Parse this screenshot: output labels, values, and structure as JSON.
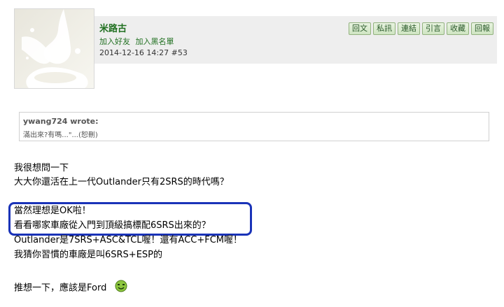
{
  "user": {
    "name": "米路古",
    "link_add_friend": "加入好友",
    "link_block": "加入黑名單",
    "post_time": "2014-12-16 14:27",
    "post_number": "#53"
  },
  "actions": [
    "回文",
    "私訊",
    "連結",
    "引言",
    "收藏",
    "回報"
  ],
  "quote": {
    "author": "ywang724 wrote:",
    "text": "滿出來?有嗎...\"...(恕刪)"
  },
  "body": {
    "line1": "我很想問一下",
    "line2": "大大你還活在上一代Outlander只有2SRS的時代嗎？",
    "line3": "當然理想是OK啦！",
    "line4": "看看哪家車廠從入門到頂級搞標配6SRS出來的？",
    "line5": "Outlander是7SRS+ASC&TCL喔！還有ACC+FCM喔！",
    "line6": "我猜你習慣的車廠是叫6SRS+ESP的",
    "line7": "推想一下，應該是Ford"
  },
  "colors": {
    "highlight_border": "#1a33b8",
    "username": "#1f6f1f",
    "header_bg": "#eeeeee"
  },
  "icons": {
    "avatar": "milk-splash-avatar",
    "smiley": "green-smiley-icon"
  }
}
